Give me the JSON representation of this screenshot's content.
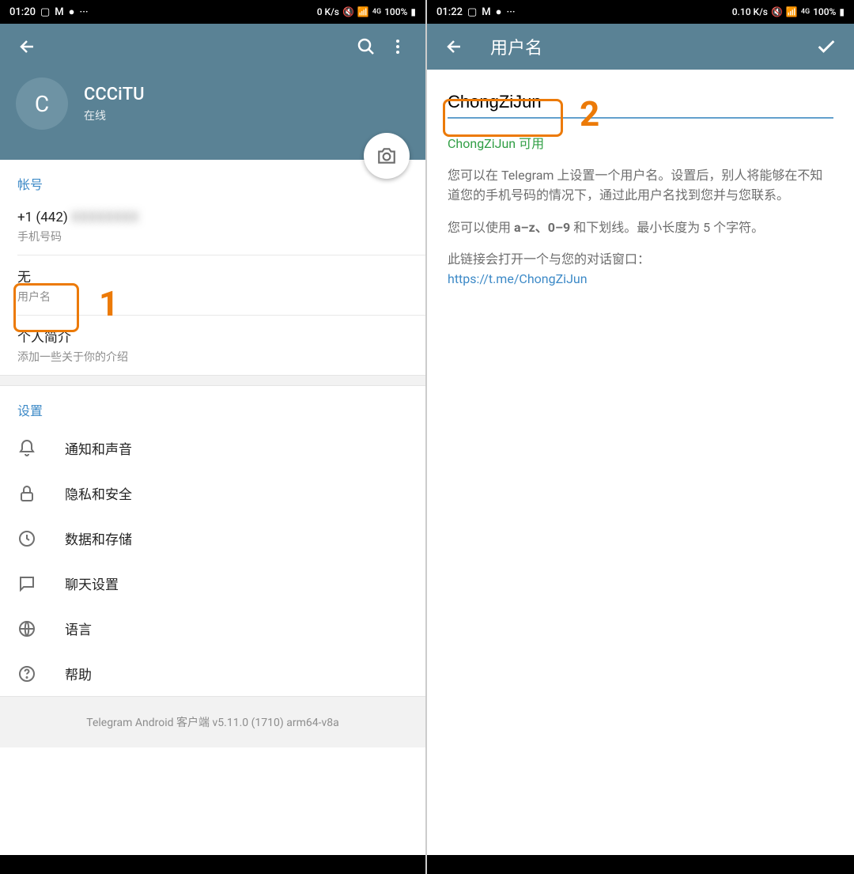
{
  "left": {
    "status": {
      "time": "01:20",
      "speed": "0 K/s",
      "battery": "100%"
    },
    "profile": {
      "initial": "C",
      "name": "CCCiTU",
      "status": "在线"
    },
    "account": {
      "header": "帐号",
      "phone_value": "+1 (442)",
      "phone_hidden": "XXXXXXXX",
      "phone_label": "手机号码",
      "username_value": "无",
      "username_label": "用户名",
      "bio_value": "个人简介",
      "bio_label": "添加一些关于你的介绍"
    },
    "settings": {
      "header": "设置",
      "items": [
        {
          "label": "通知和声音",
          "icon": "bell"
        },
        {
          "label": "隐私和安全",
          "icon": "lock"
        },
        {
          "label": "数据和存储",
          "icon": "clock"
        },
        {
          "label": "聊天设置",
          "icon": "chat"
        },
        {
          "label": "语言",
          "icon": "globe"
        },
        {
          "label": "帮助",
          "icon": "help"
        }
      ]
    },
    "version": "Telegram Android 客户端 v5.11.0 (1710) arm64-v8a",
    "annotation": "1"
  },
  "right": {
    "status": {
      "time": "01:22",
      "speed": "0.10 K/s",
      "battery": "100%"
    },
    "appbar_title": "用户名",
    "input_value": "ChongZiJun",
    "availability": "ChongZiJun 可用",
    "desc1": "您可以在 Telegram 上设置一个用户名。设置后，别人将能够在不知道您的手机号码的情况下，通过此用户名找到您并与您联系。",
    "desc2_prefix": "您可以使用 ",
    "desc2_rules": "a–z、0–9",
    "desc2_suffix": " 和下划线。最小长度为 5 个字符。",
    "desc3": "此链接会打开一个与您的对话窗口：",
    "link": "https://t.me/ChongZiJun",
    "annotation": "2"
  }
}
